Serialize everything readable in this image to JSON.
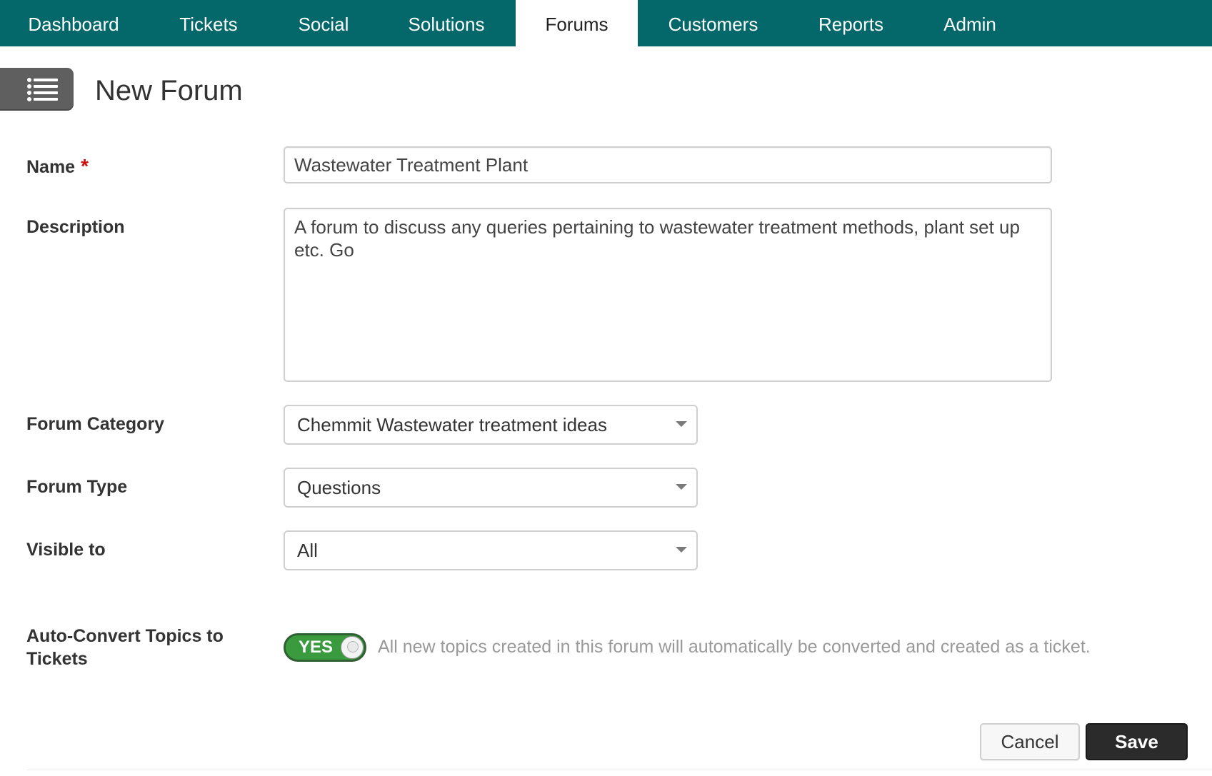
{
  "nav": {
    "items": [
      {
        "label": "Dashboard"
      },
      {
        "label": "Tickets"
      },
      {
        "label": "Social"
      },
      {
        "label": "Solutions"
      },
      {
        "label": "Forums",
        "active": true
      },
      {
        "label": "Customers"
      },
      {
        "label": "Reports"
      },
      {
        "label": "Admin"
      }
    ]
  },
  "header": {
    "menu_icon": "list-icon",
    "title": "New Forum"
  },
  "form": {
    "name": {
      "label": "Name",
      "required_mark": "*",
      "value": "Wastewater Treatment Plant"
    },
    "description": {
      "label": "Description",
      "value": "A forum to discuss any queries pertaining to wastewater treatment methods, plant set up etc. Go"
    },
    "category": {
      "label": "Forum Category",
      "value": "Chemmit Wastewater treatment ideas"
    },
    "type": {
      "label": "Forum Type",
      "value": "Questions"
    },
    "visibility": {
      "label": "Visible to",
      "value": "All"
    },
    "auto_convert": {
      "label": "Auto-Convert Topics to Tickets",
      "state": "YES",
      "help": "All new topics created in this forum will automatically be converted and created as a ticket."
    }
  },
  "actions": {
    "cancel": "Cancel",
    "save": "Save"
  },
  "colors": {
    "nav_bg": "#04686a",
    "toggle_on": "#3a9a3e",
    "required": "#cc1111",
    "save_bg": "#2b2b2b"
  }
}
